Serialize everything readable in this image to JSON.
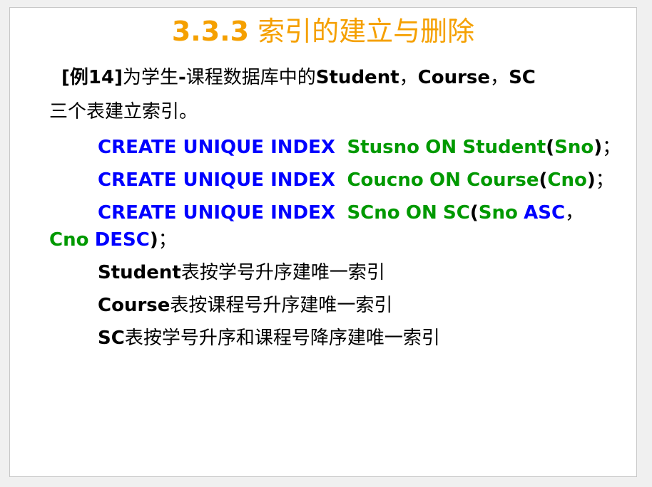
{
  "slide": {
    "title_num": "3.3.3",
    "title_text": " 索引的建立与删除",
    "example": {
      "tag": "[例14]",
      "text1": "为学生",
      "dash": "-",
      "text2": "课程数据库中的",
      "tables": "Student",
      "sep1": "，",
      "t2": "Course",
      "sep2": "，",
      "t3": "SC",
      "line2": "三个表建立索引。"
    },
    "sql": [
      {
        "kw": "CREATE UNIQUE INDEX",
        "name": "Stusno",
        "on": "ON",
        "table": "Student",
        "lp": "(",
        "col": "Sno",
        "rp": ")",
        "end": "；"
      },
      {
        "kw": "CREATE UNIQUE INDEX",
        "name": "Coucno",
        "on": "ON",
        "table": "Course",
        "lp": "(",
        "col": "Cno",
        "rp": ")",
        "end": "；"
      },
      {
        "kw": "CREATE UNIQUE INDEX",
        "name": "SCno",
        "on": "ON",
        "table": "SC",
        "lp": "(",
        "col1": "Sno",
        "ord1": "ASC",
        "comma": "，",
        "col2": "Cno",
        "ord2": "DESC",
        "rp": ")",
        "end": "；"
      }
    ],
    "descs": [
      {
        "name": "Student",
        "text": "表按学号升序建唯一索引"
      },
      {
        "name": "Course",
        "text": "表按课程号升序建唯一索引"
      },
      {
        "name": "SC",
        "text": "表按学号升序和课程号降序建唯一索引"
      }
    ]
  }
}
